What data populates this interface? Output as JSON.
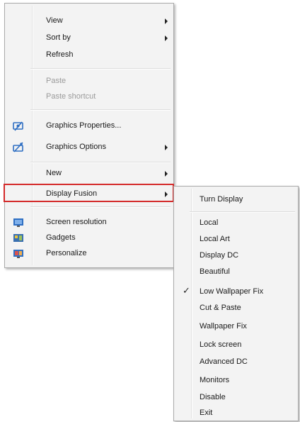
{
  "main_menu": {
    "items": [
      {
        "label": "View",
        "has_submenu": true
      },
      {
        "label": "Sort by",
        "has_submenu": true
      },
      {
        "label": "Refresh",
        "has_submenu": false
      },
      {
        "label": "Paste",
        "has_submenu": false,
        "disabled": true
      },
      {
        "label": "Paste shortcut",
        "has_submenu": false,
        "disabled": true
      },
      {
        "label": "Graphics Properties...",
        "icon": "graphics-properties-icon",
        "has_submenu": false
      },
      {
        "label": "Graphics Options",
        "icon": "graphics-options-icon",
        "has_submenu": true
      },
      {
        "label": "New",
        "has_submenu": true
      },
      {
        "label": "Display Fusion",
        "has_submenu": true
      },
      {
        "label": "Screen resolution",
        "icon": "screen-resolution-icon",
        "has_submenu": false
      },
      {
        "label": "Gadgets",
        "icon": "gadgets-icon",
        "has_submenu": false
      },
      {
        "label": "Personalize",
        "icon": "personalize-icon",
        "has_submenu": false
      }
    ]
  },
  "sub_menu": {
    "items": [
      {
        "label": "Turn Display"
      },
      {
        "label": "Local"
      },
      {
        "label": "Local Art"
      },
      {
        "label": "Display DC"
      },
      {
        "label": "Beautiful"
      },
      {
        "label": "Low Wallpaper Fix",
        "checked": true
      },
      {
        "label": "Cut & Paste"
      },
      {
        "label": "Wallpaper Fix"
      },
      {
        "label": "Lock screen"
      },
      {
        "label": "Advanced DC"
      },
      {
        "label": "Monitors"
      },
      {
        "label": "Disable"
      },
      {
        "label": "Exit"
      }
    ]
  },
  "colors": {
    "menu_background": "#f3f3f3",
    "highlight_border": "#d42a2a",
    "icon_blue": "#2f6fc3"
  }
}
